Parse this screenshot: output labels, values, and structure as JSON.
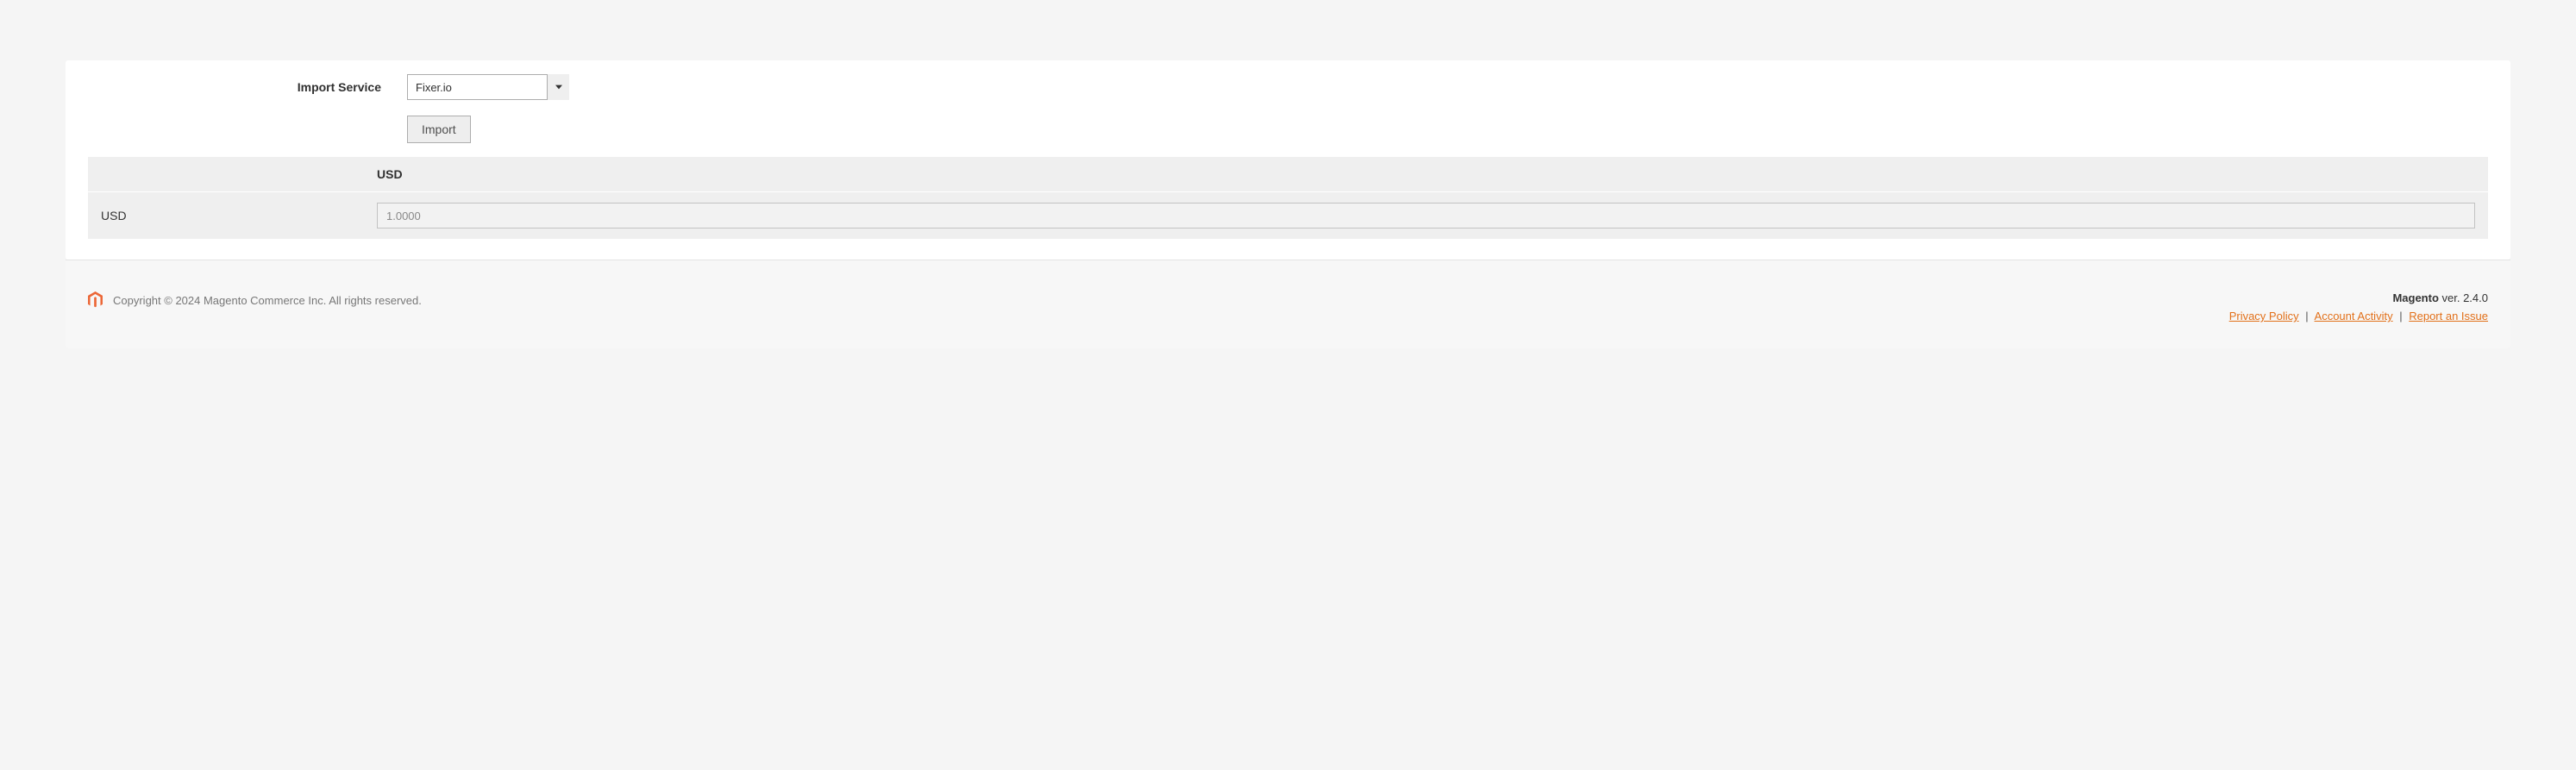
{
  "form": {
    "import_service_label": "Import Service",
    "import_service_value": "Fixer.io",
    "import_button_label": "Import"
  },
  "rates": {
    "column_header": "USD",
    "row_header": "USD",
    "value": "1.0000"
  },
  "footer": {
    "copyright": "Copyright © 2024 Magento Commerce Inc. All rights reserved.",
    "brand": "Magento",
    "version_prefix": " ver. ",
    "version": "2.4.0",
    "privacy_policy": "Privacy Policy",
    "account_activity": " Account Activity",
    "report_issue": "Report an Issue"
  }
}
